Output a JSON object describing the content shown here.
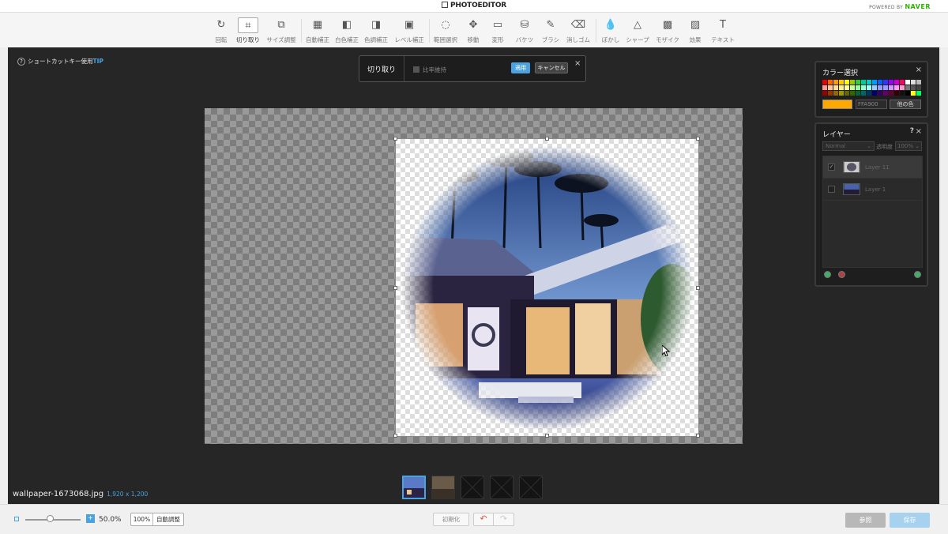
{
  "header": {
    "app_title": "PHOTOEDITOR",
    "powered_prefix": "POWERED BY",
    "powered_brand": "NAVER"
  },
  "toolbar": {
    "tools": [
      {
        "id": "rotate",
        "label": "回転",
        "icon": "↻"
      },
      {
        "id": "crop",
        "label": "切り取り",
        "icon": "⌗",
        "active": true
      },
      {
        "id": "resize",
        "label": "サイズ調整",
        "icon": "⧉"
      },
      {
        "id": "auto-correct",
        "label": "自動補正",
        "icon": "▦"
      },
      {
        "id": "wb-correct",
        "label": "白色補正",
        "icon": "◧"
      },
      {
        "id": "tone-correct",
        "label": "色調補正",
        "icon": "◨"
      },
      {
        "id": "level-correct",
        "label": "レベル補正",
        "icon": "▣"
      },
      {
        "id": "range-select",
        "label": "範囲選択",
        "icon": "◌"
      },
      {
        "id": "move",
        "label": "移動",
        "icon": "✥"
      },
      {
        "id": "transform",
        "label": "変形",
        "icon": "▭"
      },
      {
        "id": "bucket",
        "label": "バケツ",
        "icon": "⛁"
      },
      {
        "id": "brush",
        "label": "ブラシ",
        "icon": "✎"
      },
      {
        "id": "eraser",
        "label": "消しゴム",
        "icon": "⌫"
      },
      {
        "id": "blur",
        "label": "ぼかし",
        "icon": "💧"
      },
      {
        "id": "sharpen",
        "label": "シャープ",
        "icon": "△"
      },
      {
        "id": "mosaic",
        "label": "モザイク",
        "icon": "▩"
      },
      {
        "id": "effects",
        "label": "効果",
        "icon": "▨"
      },
      {
        "id": "text",
        "label": "テキスト",
        "icon": "T"
      }
    ]
  },
  "workspace": {
    "tip_prefix": "ショートカットキー使用",
    "tip_suffix": "TIP",
    "tip_icon": "?",
    "file_name": "wallpaper-1673068.jpg",
    "file_dims": "1,920 x 1,200"
  },
  "crop_bar": {
    "title": "切り取り",
    "ratio_label": "比率維持",
    "apply": "適用",
    "cancel": "キャンセル",
    "close": "×"
  },
  "color_panel": {
    "title": "カラー選択",
    "close": "×",
    "hex": "FFA900",
    "current_color": "#FFA900",
    "button": "他の色"
  },
  "layer_panel": {
    "title": "レイヤー",
    "help": "?",
    "close": "×",
    "blend_mode": "Normal",
    "opacity_label": "透明度",
    "opacity_value": "100%",
    "layers": [
      {
        "name": "Layer 11",
        "checked": true,
        "selected": true
      },
      {
        "name": "Layer 1",
        "checked": false,
        "selected": false
      }
    ]
  },
  "bottom": {
    "zoom_value": "50.0%",
    "zoom_plus": "+",
    "btn_100": "100%",
    "btn_auto": "自動調整",
    "reset": "初期化",
    "undo": "↶",
    "redo": "↷",
    "browse": "参照",
    "save": "保存"
  }
}
